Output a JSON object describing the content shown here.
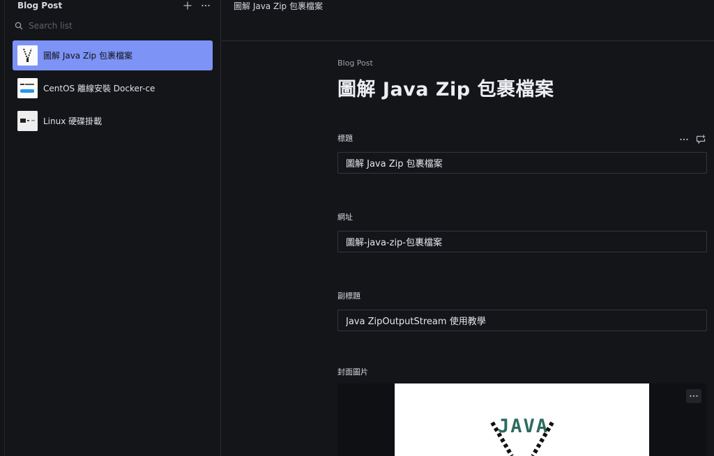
{
  "sidebar": {
    "title": "Blog Post",
    "search_placeholder": "Search list",
    "items": [
      {
        "label": "圖解 Java Zip 包裹檔案",
        "active": true
      },
      {
        "label": "CentOS 離線安裝 Docker-ce",
        "active": false
      },
      {
        "label": "Linux 硬碟掛載",
        "active": false
      }
    ]
  },
  "topbar": {
    "title": "圖解 Java Zip 包裹檔案"
  },
  "document": {
    "type_label": "Blog Post",
    "heading": "圖解 Java Zip 包裹檔案",
    "fields": {
      "title": {
        "label": "標題",
        "value": "圖解 Java Zip 包裹檔案"
      },
      "slug": {
        "label": "網址",
        "value": "圖解-java-zip-包裹檔案"
      },
      "subtitle": {
        "label": "副標題",
        "value": "Java ZipOutputStream 使用教學"
      },
      "cover": {
        "label": "封面圖片",
        "image_text": "JAVA"
      }
    }
  },
  "icons": {
    "add": "plus-icon",
    "menu": "ellipsis-icon",
    "search": "search-icon",
    "comment": "comment-add-icon"
  },
  "colors": {
    "background": "#141519",
    "active_item": "#7d93f5",
    "border": "#33353d",
    "java_green": "#2e6b5f"
  }
}
